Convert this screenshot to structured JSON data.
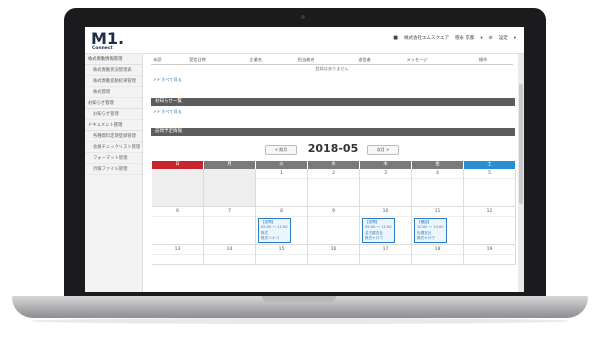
{
  "header": {
    "logo_mark": "M1.",
    "logo_sub": "Connect",
    "user_company": "株式会社エムスクエア",
    "user_name": "徳永 京都",
    "settings": "設定"
  },
  "sidebar": {
    "groups": [
      {
        "label": "株式異動情報管理",
        "items": [
          "株式異動状況管理表",
          "株式異動変動結果管理",
          "株式管理"
        ]
      },
      {
        "label": "お知らせ管理",
        "items": [
          "お知らせ管理"
        ]
      },
      {
        "label": "ドキュメント管理",
        "items": [
          "各種資料定期登録管理",
          "会員チェックリスト管理",
          "フォーマット管理",
          "月報ファイル管理"
        ]
      }
    ]
  },
  "messages": {
    "columns": [
      "未読",
      "受信日時",
      "企業名",
      "担当者名",
      "送信者",
      "メッセージ",
      "操作"
    ],
    "empty_text": "登録はありません",
    "see_all": ">> すべて見る"
  },
  "notices": {
    "title": "お知らせ一覧",
    "see_all": ">> すべて見る"
  },
  "schedule": {
    "title": "訪問予定情報",
    "prev_label": "< 前月",
    "next_label": "次月 >",
    "month_title": "2018-05",
    "dow": [
      "日",
      "月",
      "火",
      "水",
      "木",
      "金",
      "土"
    ],
    "weeks": [
      [
        "",
        "",
        "1",
        "2",
        "3",
        "4",
        "5"
      ],
      [
        "6",
        "7",
        "8",
        "9",
        "10",
        "11",
        "12"
      ],
      [
        "13",
        "14",
        "15",
        "16",
        "17",
        "18",
        "19"
      ]
    ],
    "events": [
      {
        "day": "8",
        "lines": [
          "【訪問】",
          "09:00 ～ 11:00",
          "株式",
          "株式ハナコ"
        ]
      },
      {
        "day": "10",
        "lines": [
          "【訪問】",
          "09:00 ～ 11:00",
          "名古屋支社",
          "株式ヤロウ"
        ]
      },
      {
        "day": "11",
        "lines": [
          "【確認】",
          "10:00 ～ 13:00",
          "札幌支社",
          "株式ヤロウ"
        ]
      }
    ]
  },
  "colors": {
    "sunday": "#c7252b",
    "saturday": "#2a8fd0",
    "weekday_header": "#7a7a7a",
    "section_bar": "#5d5d5d",
    "link": "#2b7bc0"
  }
}
